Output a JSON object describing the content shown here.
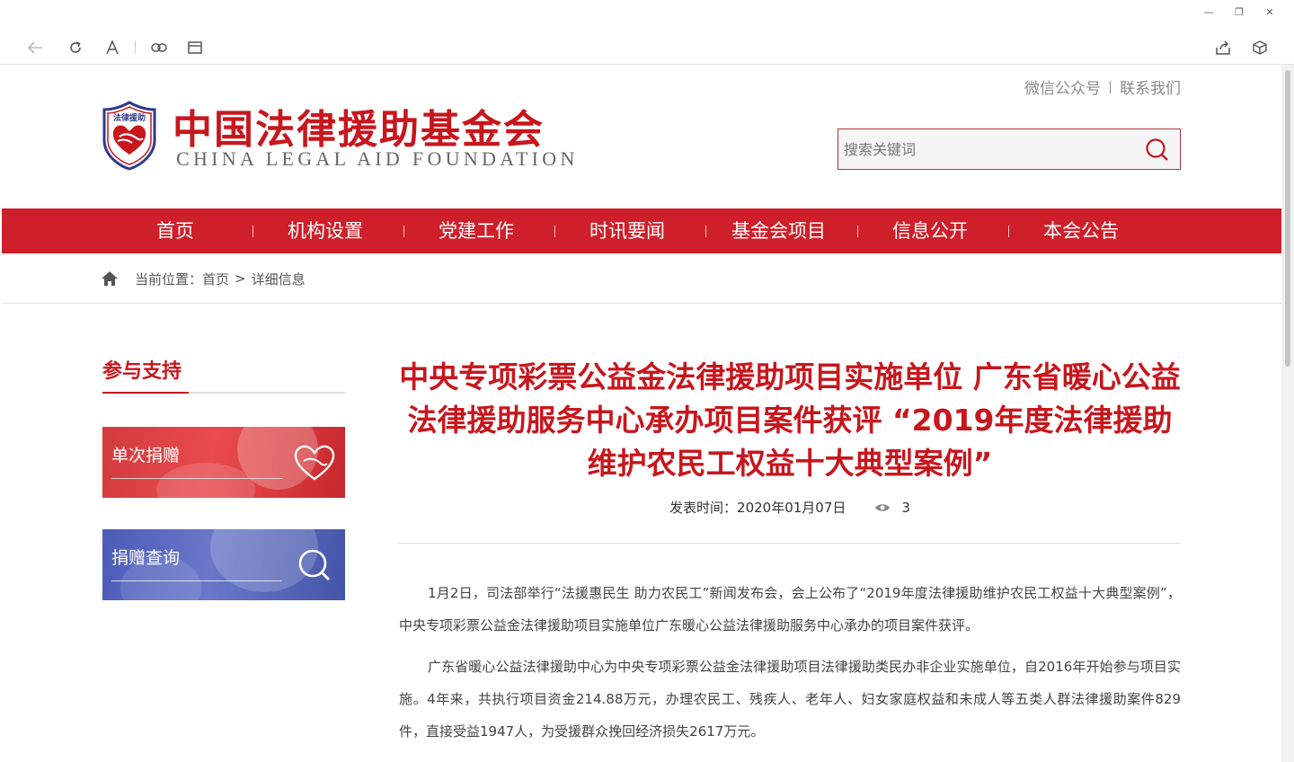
{
  "browser": {
    "window_controls": [
      "—",
      "❐",
      "✕"
    ],
    "toolbar_icons": [
      "back-icon",
      "reload-icon",
      "font-icon",
      "link-icon",
      "tab-icon",
      "share-icon",
      "extension-icon"
    ]
  },
  "header": {
    "top_links": [
      "微信公众号",
      "联系我们"
    ],
    "logo_badge_text": "法律援助",
    "site_title": "中国法律援助基金会",
    "site_subtitle": "CHINA LEGAL AID FOUNDATION",
    "search_placeholder": "搜索关键词"
  },
  "nav": {
    "items": [
      "首页",
      "机构设置",
      "党建工作",
      "时讯要闻",
      "基金会项目",
      "信息公开",
      "本会公告"
    ],
    "background_color": "#cf1f2a"
  },
  "breadcrumb": {
    "label": "当前位置：",
    "home": "首页",
    "separator": ">",
    "current": "详细信息"
  },
  "sidebar": {
    "title": "参与支持",
    "cards": [
      {
        "label": "单次捐赠",
        "icon": "heart-icon"
      },
      {
        "label": "捐赠查询",
        "icon": "search-icon"
      }
    ]
  },
  "article": {
    "title": "中央专项彩票公益金法律援助项目实施单位 广东省暖心公益法律援助服务中心承办项目案件获评 “2019年度法律援助维护农民工权益十大典型案例”",
    "publish_label": "发表时间：",
    "publish_date": "2020年01月07日",
    "views": "3",
    "paragraphs": [
      "1月2日，司法部举行“法援惠民生 助力农民工”新闻发布会，会上公布了“2019年度法律援助维护农民工权益十大典型案例”，中央专项彩票公益金法律援助项目实施单位广东暖心公益法律援助服务中心承办的项目案件获评。",
      "广东省暖心公益法律援助中心为中央专项彩票公益金法律援助项目法律援助类民办非企业实施单位，自2016年开始参与项目实施。4年来，共执行项目资金214.88万元，办理农民工、残疾人、老年人、妇女家庭权益和未成人等五类人群法律援助案件829件，直接受益1947人，为受援群众挽回经济损失2617万元。"
    ],
    "accent_color": "#c8161d"
  }
}
